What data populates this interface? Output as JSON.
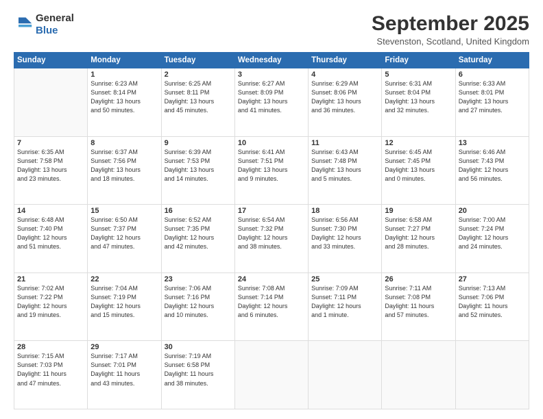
{
  "header": {
    "logo_line1": "General",
    "logo_line2": "Blue",
    "month": "September 2025",
    "location": "Stevenston, Scotland, United Kingdom"
  },
  "weekdays": [
    "Sunday",
    "Monday",
    "Tuesday",
    "Wednesday",
    "Thursday",
    "Friday",
    "Saturday"
  ],
  "weeks": [
    [
      {
        "day": "",
        "info": ""
      },
      {
        "day": "1",
        "info": "Sunrise: 6:23 AM\nSunset: 8:14 PM\nDaylight: 13 hours\nand 50 minutes."
      },
      {
        "day": "2",
        "info": "Sunrise: 6:25 AM\nSunset: 8:11 PM\nDaylight: 13 hours\nand 45 minutes."
      },
      {
        "day": "3",
        "info": "Sunrise: 6:27 AM\nSunset: 8:09 PM\nDaylight: 13 hours\nand 41 minutes."
      },
      {
        "day": "4",
        "info": "Sunrise: 6:29 AM\nSunset: 8:06 PM\nDaylight: 13 hours\nand 36 minutes."
      },
      {
        "day": "5",
        "info": "Sunrise: 6:31 AM\nSunset: 8:04 PM\nDaylight: 13 hours\nand 32 minutes."
      },
      {
        "day": "6",
        "info": "Sunrise: 6:33 AM\nSunset: 8:01 PM\nDaylight: 13 hours\nand 27 minutes."
      }
    ],
    [
      {
        "day": "7",
        "info": "Sunrise: 6:35 AM\nSunset: 7:58 PM\nDaylight: 13 hours\nand 23 minutes."
      },
      {
        "day": "8",
        "info": "Sunrise: 6:37 AM\nSunset: 7:56 PM\nDaylight: 13 hours\nand 18 minutes."
      },
      {
        "day": "9",
        "info": "Sunrise: 6:39 AM\nSunset: 7:53 PM\nDaylight: 13 hours\nand 14 minutes."
      },
      {
        "day": "10",
        "info": "Sunrise: 6:41 AM\nSunset: 7:51 PM\nDaylight: 13 hours\nand 9 minutes."
      },
      {
        "day": "11",
        "info": "Sunrise: 6:43 AM\nSunset: 7:48 PM\nDaylight: 13 hours\nand 5 minutes."
      },
      {
        "day": "12",
        "info": "Sunrise: 6:45 AM\nSunset: 7:45 PM\nDaylight: 13 hours\nand 0 minutes."
      },
      {
        "day": "13",
        "info": "Sunrise: 6:46 AM\nSunset: 7:43 PM\nDaylight: 12 hours\nand 56 minutes."
      }
    ],
    [
      {
        "day": "14",
        "info": "Sunrise: 6:48 AM\nSunset: 7:40 PM\nDaylight: 12 hours\nand 51 minutes."
      },
      {
        "day": "15",
        "info": "Sunrise: 6:50 AM\nSunset: 7:37 PM\nDaylight: 12 hours\nand 47 minutes."
      },
      {
        "day": "16",
        "info": "Sunrise: 6:52 AM\nSunset: 7:35 PM\nDaylight: 12 hours\nand 42 minutes."
      },
      {
        "day": "17",
        "info": "Sunrise: 6:54 AM\nSunset: 7:32 PM\nDaylight: 12 hours\nand 38 minutes."
      },
      {
        "day": "18",
        "info": "Sunrise: 6:56 AM\nSunset: 7:30 PM\nDaylight: 12 hours\nand 33 minutes."
      },
      {
        "day": "19",
        "info": "Sunrise: 6:58 AM\nSunset: 7:27 PM\nDaylight: 12 hours\nand 28 minutes."
      },
      {
        "day": "20",
        "info": "Sunrise: 7:00 AM\nSunset: 7:24 PM\nDaylight: 12 hours\nand 24 minutes."
      }
    ],
    [
      {
        "day": "21",
        "info": "Sunrise: 7:02 AM\nSunset: 7:22 PM\nDaylight: 12 hours\nand 19 minutes."
      },
      {
        "day": "22",
        "info": "Sunrise: 7:04 AM\nSunset: 7:19 PM\nDaylight: 12 hours\nand 15 minutes."
      },
      {
        "day": "23",
        "info": "Sunrise: 7:06 AM\nSunset: 7:16 PM\nDaylight: 12 hours\nand 10 minutes."
      },
      {
        "day": "24",
        "info": "Sunrise: 7:08 AM\nSunset: 7:14 PM\nDaylight: 12 hours\nand 6 minutes."
      },
      {
        "day": "25",
        "info": "Sunrise: 7:09 AM\nSunset: 7:11 PM\nDaylight: 12 hours\nand 1 minute."
      },
      {
        "day": "26",
        "info": "Sunrise: 7:11 AM\nSunset: 7:08 PM\nDaylight: 11 hours\nand 57 minutes."
      },
      {
        "day": "27",
        "info": "Sunrise: 7:13 AM\nSunset: 7:06 PM\nDaylight: 11 hours\nand 52 minutes."
      }
    ],
    [
      {
        "day": "28",
        "info": "Sunrise: 7:15 AM\nSunset: 7:03 PM\nDaylight: 11 hours\nand 47 minutes."
      },
      {
        "day": "29",
        "info": "Sunrise: 7:17 AM\nSunset: 7:01 PM\nDaylight: 11 hours\nand 43 minutes."
      },
      {
        "day": "30",
        "info": "Sunrise: 7:19 AM\nSunset: 6:58 PM\nDaylight: 11 hours\nand 38 minutes."
      },
      {
        "day": "",
        "info": ""
      },
      {
        "day": "",
        "info": ""
      },
      {
        "day": "",
        "info": ""
      },
      {
        "day": "",
        "info": ""
      }
    ]
  ]
}
